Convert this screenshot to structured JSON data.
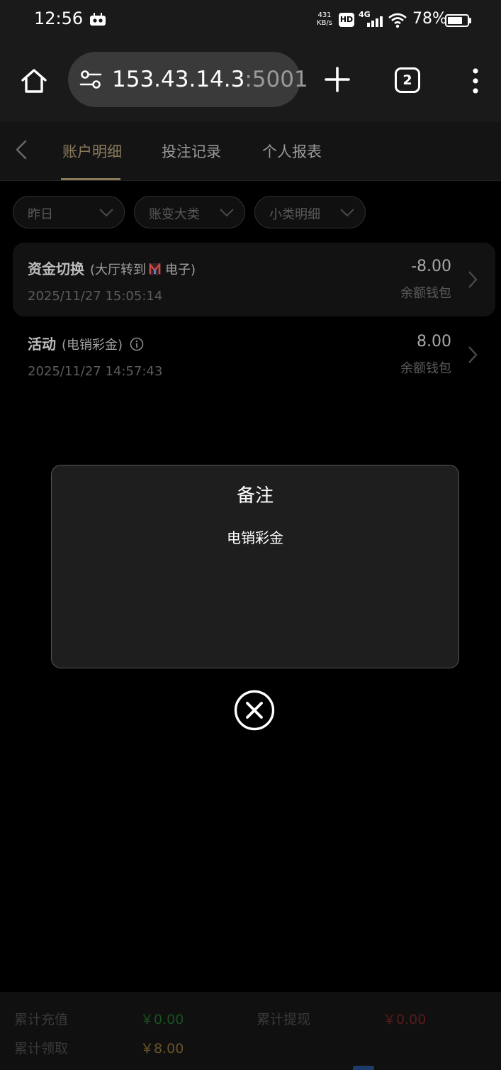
{
  "status_bar": {
    "time": "12:56",
    "net_speed_value": "431",
    "net_speed_unit": "KB/s",
    "hd_label": "HD",
    "network_type": "4G",
    "battery_percent": "78%",
    "battery_level": 0.78
  },
  "browser": {
    "url_host": "153.43.14.3",
    "url_port": ":5001",
    "tab_count": "2"
  },
  "nav": {
    "tabs": [
      {
        "label": "账户明细",
        "active": true
      },
      {
        "label": "投注记录",
        "active": false
      },
      {
        "label": "个人报表",
        "active": false
      }
    ]
  },
  "filters": [
    {
      "label": "昨日"
    },
    {
      "label": "账变大类"
    },
    {
      "label": "小类明细"
    }
  ],
  "records": [
    {
      "title": "资金切换",
      "subtitle_prefix": "(大厅转到",
      "subtitle_suffix": "电子)",
      "time": "2025/11/27 15:05:14",
      "amount": "-8.00",
      "wallet": "余额钱包"
    },
    {
      "title": "活动",
      "subtitle": "(电销彩金)",
      "time": "2025/11/27 14:57:43",
      "amount": "8.00",
      "wallet": "余额钱包"
    }
  ],
  "modal": {
    "title": "备注",
    "body": "电销彩金"
  },
  "footer": {
    "recharge_label": "累计充值",
    "recharge_value": "￥0.00",
    "withdraw_label": "累计提现",
    "withdraw_value": "￥0.00",
    "claim_label": "累计领取",
    "claim_value": "￥8.00"
  },
  "colors": {
    "accent_gold": "#8a7a5a",
    "recharge_green": "#17521f",
    "withdraw_red": "#5a1b1b",
    "claim_gold": "#6a5425"
  }
}
